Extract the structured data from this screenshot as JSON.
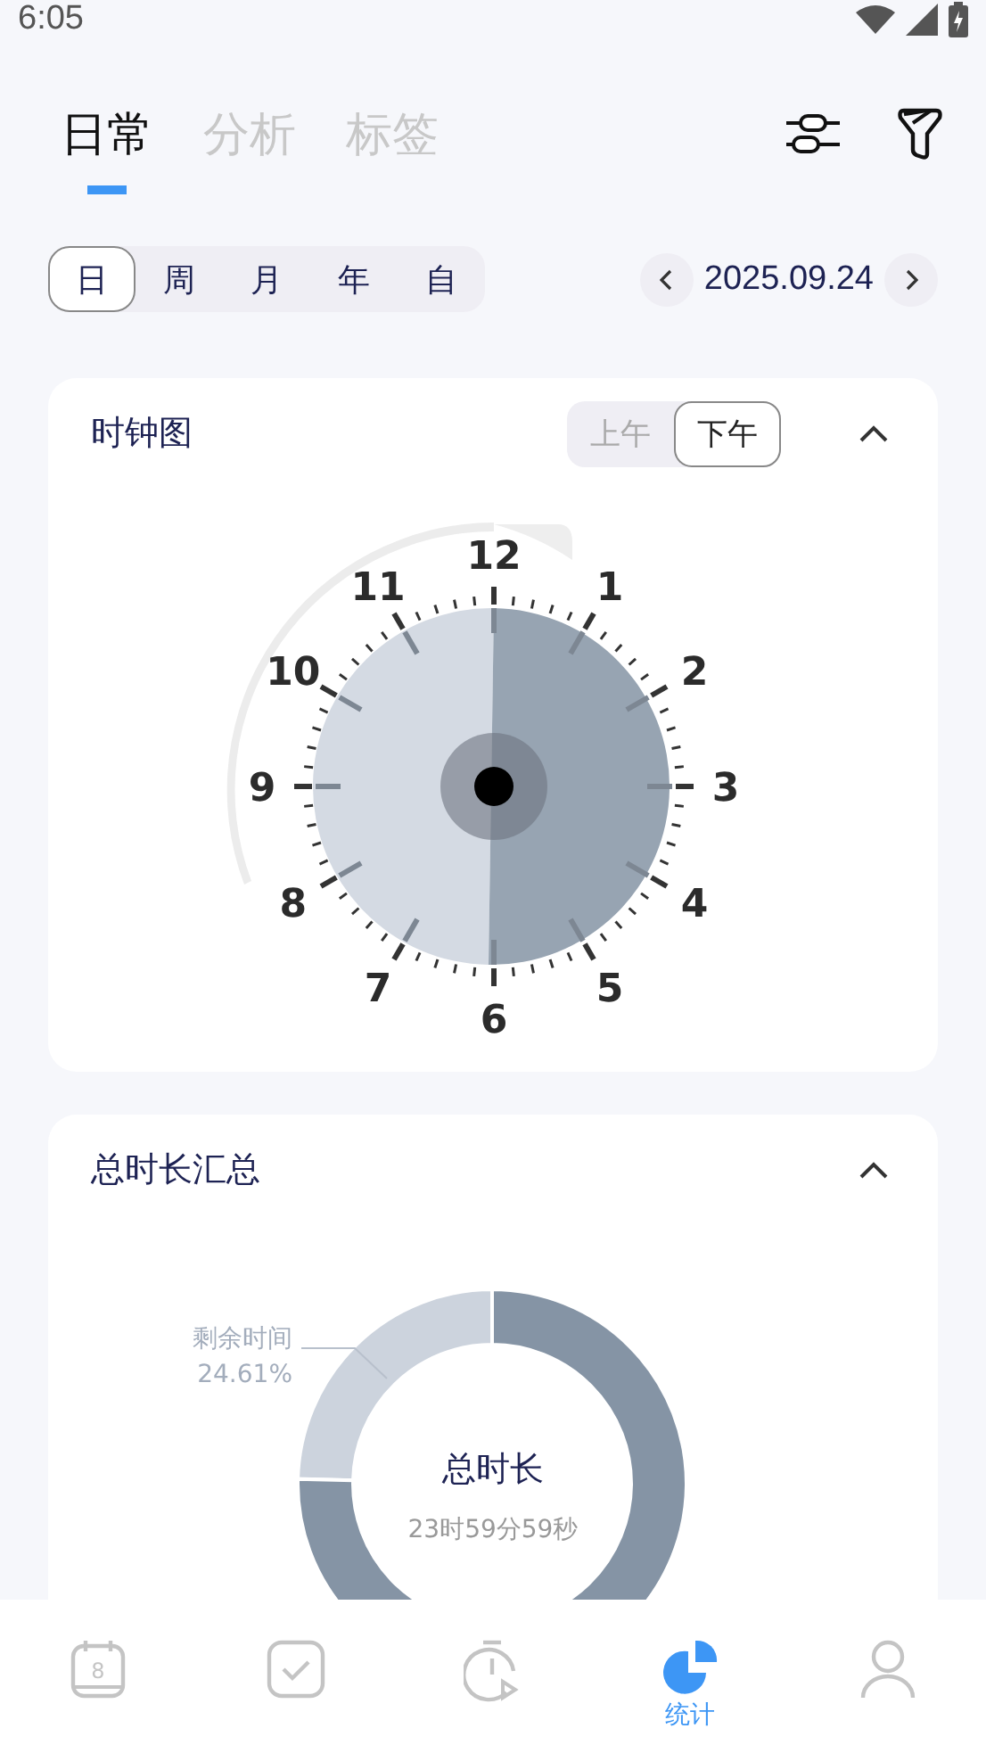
{
  "status_bar": {
    "time": "6:05"
  },
  "tabs": [
    {
      "label": "日常",
      "selected": true
    },
    {
      "label": "分析",
      "selected": false
    },
    {
      "label": "标签",
      "selected": false
    }
  ],
  "range": [
    {
      "label": "日",
      "selected": true
    },
    {
      "label": "周",
      "selected": false
    },
    {
      "label": "月",
      "selected": false
    },
    {
      "label": "年",
      "selected": false
    },
    {
      "label": "自",
      "selected": false
    }
  ],
  "date": "2025.09.24",
  "clock_card": {
    "title": "时钟图",
    "periods": [
      {
        "label": "上午",
        "selected": false
      },
      {
        "label": "下午",
        "selected": true
      }
    ],
    "expanded": true,
    "hours": [
      "12",
      "1",
      "2",
      "3",
      "4",
      "5",
      "6",
      "7",
      "8",
      "9",
      "10",
      "11"
    ]
  },
  "summary_card": {
    "title": "总时长汇总",
    "expanded": true,
    "center_title": "总时长",
    "center_value": "23时59分59秒",
    "chart_data": {
      "type": "donut",
      "categories": [
        "剩余时间",
        null
      ],
      "values": [
        24.61,
        75.39
      ],
      "value_labels": [
        "24.61%",
        null
      ]
    }
  },
  "bottom_nav": [
    {
      "kind": "calendar",
      "icon_text": "8",
      "selected": false
    },
    {
      "kind": "tasks",
      "selected": false
    },
    {
      "kind": "timer",
      "selected": false
    },
    {
      "kind": "stats",
      "label": "统计",
      "selected": true
    },
    {
      "kind": "profile",
      "selected": false
    }
  ]
}
